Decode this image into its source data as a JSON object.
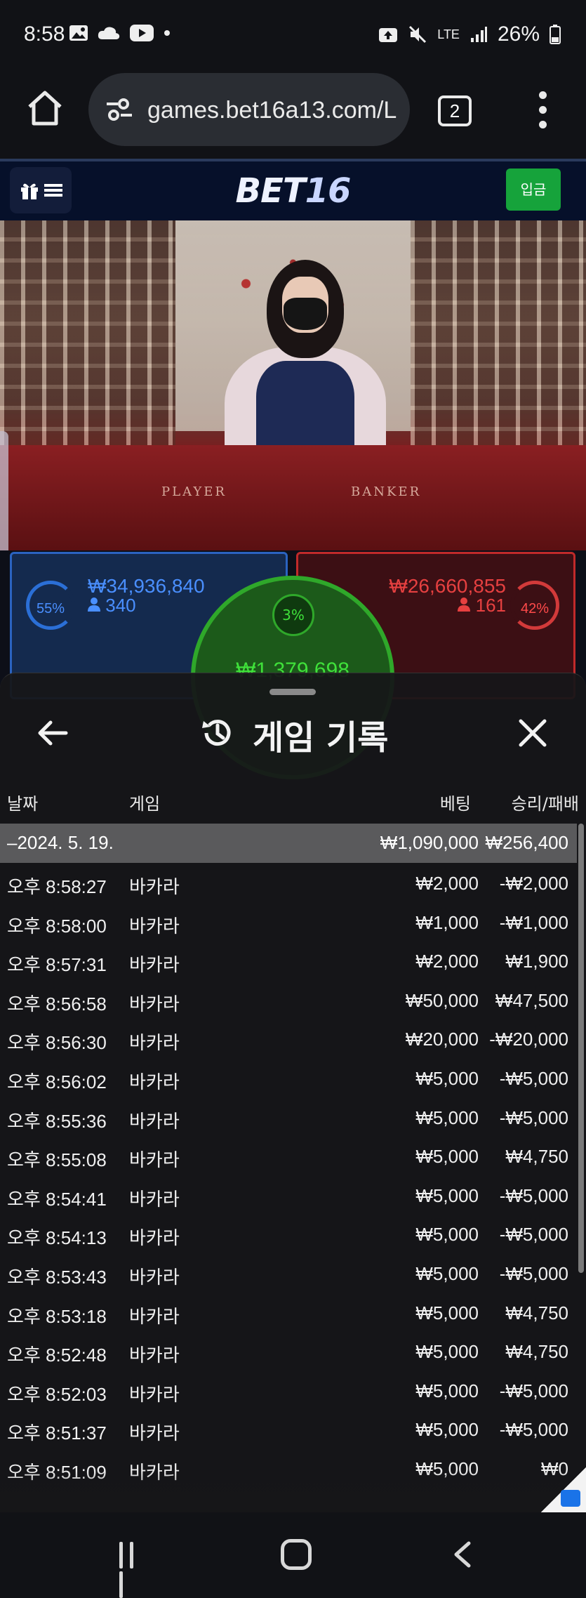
{
  "status_bar": {
    "time": "8:58",
    "battery": "26%",
    "network": "LTE"
  },
  "browser": {
    "url": "games.bet16a13.com/L",
    "tab_count": "2"
  },
  "site": {
    "logo_main": "BET",
    "logo_num": "16",
    "deposit_label": "입금"
  },
  "video": {
    "table_left": "PLAYER",
    "table_right": "BANKER"
  },
  "betting": {
    "player": {
      "percent": "55%",
      "amount": "₩34,936,840",
      "count": "340"
    },
    "banker": {
      "percent": "42%",
      "amount": "₩26,660,855",
      "count": "161"
    },
    "tie": {
      "percent": "3%",
      "amount": "₩1,379,698"
    }
  },
  "modal": {
    "title": "게임 기록",
    "columns": {
      "date": "날짜",
      "game": "게임",
      "bet": "베팅",
      "result": "승리/패배"
    },
    "total": {
      "date": "–2024. 5. 19.",
      "bet": "₩1,090,000",
      "result": "₩256,400"
    },
    "rows": [
      {
        "date": "오후 8:58:27",
        "game": "바카라",
        "bet": "₩2,000",
        "result": "-₩2,000"
      },
      {
        "date": "오후 8:58:00",
        "game": "바카라",
        "bet": "₩1,000",
        "result": "-₩1,000"
      },
      {
        "date": "오후 8:57:31",
        "game": "바카라",
        "bet": "₩2,000",
        "result": "₩1,900"
      },
      {
        "date": "오후 8:56:58",
        "game": "바카라",
        "bet": "₩50,000",
        "result": "₩47,500"
      },
      {
        "date": "오후 8:56:30",
        "game": "바카라",
        "bet": "₩20,000",
        "result": "-₩20,000"
      },
      {
        "date": "오후 8:56:02",
        "game": "바카라",
        "bet": "₩5,000",
        "result": "-₩5,000"
      },
      {
        "date": "오후 8:55:36",
        "game": "바카라",
        "bet": "₩5,000",
        "result": "-₩5,000"
      },
      {
        "date": "오후 8:55:08",
        "game": "바카라",
        "bet": "₩5,000",
        "result": "₩4,750"
      },
      {
        "date": "오후 8:54:41",
        "game": "바카라",
        "bet": "₩5,000",
        "result": "-₩5,000"
      },
      {
        "date": "오후 8:54:13",
        "game": "바카라",
        "bet": "₩5,000",
        "result": "-₩5,000"
      },
      {
        "date": "오후 8:53:43",
        "game": "바카라",
        "bet": "₩5,000",
        "result": "-₩5,000"
      },
      {
        "date": "오후 8:53:18",
        "game": "바카라",
        "bet": "₩5,000",
        "result": "₩4,750"
      },
      {
        "date": "오후 8:52:48",
        "game": "바카라",
        "bet": "₩5,000",
        "result": "₩4,750"
      },
      {
        "date": "오후 8:52:03",
        "game": "바카라",
        "bet": "₩5,000",
        "result": "-₩5,000"
      },
      {
        "date": "오후 8:51:37",
        "game": "바카라",
        "bet": "₩5,000",
        "result": "-₩5,000"
      },
      {
        "date": "오후 8:51:09",
        "game": "바카라",
        "bet": "₩5,000",
        "result": "₩0"
      }
    ]
  }
}
